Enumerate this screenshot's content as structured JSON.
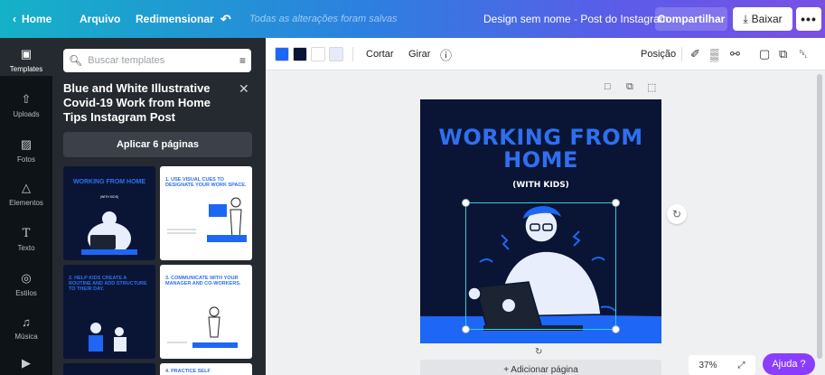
{
  "topbar": {
    "home": "Home",
    "file": "Arquivo",
    "resize": "Redimensionar",
    "saved_status": "Todas as alterações foram salvas",
    "doc_title": "Design sem nome - Post do Instagram",
    "share": "Compartilhar",
    "download": "Baixar",
    "more": "•••"
  },
  "rail": {
    "items": [
      {
        "label": "Templates",
        "icon": "templates-icon",
        "active": true
      },
      {
        "label": "Uploads",
        "icon": "upload-icon"
      },
      {
        "label": "Fotos",
        "icon": "photos-icon"
      },
      {
        "label": "Elementos",
        "icon": "elements-icon"
      },
      {
        "label": "Texto",
        "icon": "text-icon"
      },
      {
        "label": "Estilos",
        "icon": "styles-icon"
      },
      {
        "label": "Música",
        "icon": "music-icon"
      },
      {
        "label": "",
        "icon": "video-icon"
      }
    ]
  },
  "panel": {
    "search_placeholder": "Buscar templates",
    "title": "Blue and White Illustrative Covid-19 Work from Home Tips Instagram Post",
    "apply": "Aplicar 6 páginas",
    "thumbs": [
      {
        "text": "WORKING FROM HOME",
        "sub": "(WITH KIDS)"
      },
      {
        "text": "1. USE VISUAL CUES TO DESIGNATE YOUR WORK SPACE."
      },
      {
        "text": "2. HELP KIDS CREATE A ROUTINE AND ADD STRUCTURE TO THEIR DAY."
      },
      {
        "text": "3. COMMUNICATE WITH YOUR MANAGER AND CO-WORKERS."
      },
      {
        "text": ""
      },
      {
        "text": "4. PRACTICE SELF"
      }
    ]
  },
  "toolbar": {
    "swatches": [
      "#1e66f5",
      "#0a1535",
      "#ffffff",
      "#e6ebfa"
    ],
    "crop": "Cortar",
    "flip": "Girar",
    "position": "Posição"
  },
  "canvas": {
    "headline": "WORKING FROM HOME",
    "subline": "(WITH KIDS)",
    "add_page": "+ Adicionar página",
    "zoom": "37%",
    "help": "Ajuda ?"
  },
  "colors": {
    "accent_blue": "#2f6ff0",
    "page_bg": "#0a1535",
    "help_purple": "#8b3dff"
  }
}
